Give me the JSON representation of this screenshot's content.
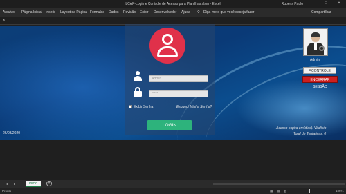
{
  "window": {
    "title": "LCAP-Login e Controle de Acesso para Planilhas.xlsm  -  Excel",
    "user": "Rubens Paulo",
    "min_icon": "minimize-icon",
    "max_icon": "maximize-icon",
    "close_icon": "close-icon"
  },
  "ribbon": {
    "tabs": [
      "Arquivo",
      "Página Inicial",
      "Inserir",
      "Layout da Página",
      "Fórmulas",
      "Dados",
      "Revisão",
      "Exibir",
      "Desenvolvedor",
      "Ajuda"
    ],
    "tell_me": "Diga-me o que você deseja fazer",
    "share": "Compartilhar"
  },
  "login": {
    "user_placeholder": "Admin",
    "password_placeholder": "*****",
    "show_password": "Exibir Senha",
    "forgot": "Esqueci Minha Senha?",
    "button": "LOGIN"
  },
  "admin": {
    "name": "Admin",
    "controle_button": "F.CONTROLE",
    "encerrar_button": "ENCERRAR SESSÃO"
  },
  "info": {
    "date": "26/03/2020",
    "expire": "Acesso expira em(dias): Vitalício",
    "attempts": "Total de Tentativas:   0"
  },
  "sheets": {
    "active": "Início"
  },
  "status": {
    "ready": "Pronto",
    "zoom": "105%"
  },
  "colors": {
    "accent_red": "#e0314a",
    "login_green": "#2db37c",
    "encerrar_red": "#cc1f1f",
    "excel_green": "#1b7a43"
  }
}
